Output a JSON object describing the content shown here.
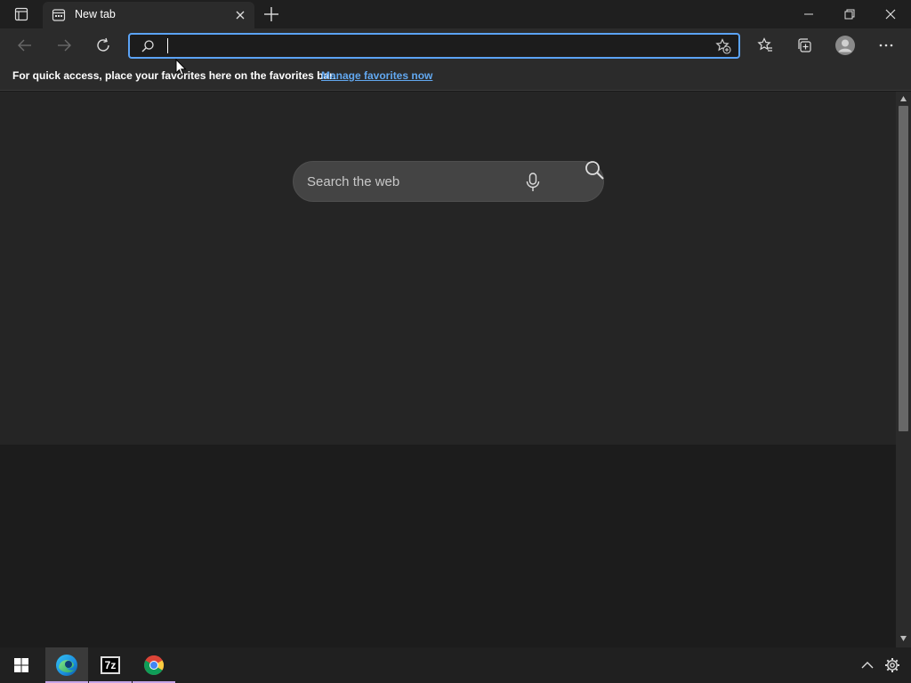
{
  "browser": {
    "tab": {
      "title": "New tab"
    },
    "address_bar": {
      "value": "",
      "placeholder": ""
    },
    "favorites_bar": {
      "message": "For quick access, place your favorites here on the favorites bar.",
      "link": "Manage favorites now"
    }
  },
  "new_tab_page": {
    "search": {
      "placeholder": "Search the web"
    }
  },
  "icons": {
    "tab_actions": "tab-actions-icon",
    "tab_page": "newtab-page-icon",
    "back": "arrow-left-icon",
    "forward": "arrow-right-icon",
    "refresh": "refresh-icon",
    "address_search": "search-icon",
    "add_favorite": "star-plus-icon",
    "favorites": "star-list-icon",
    "collections": "collections-icon",
    "profile": "avatar-icon",
    "more": "ellipsis-icon",
    "mic": "microphone-icon",
    "windows": "windows-logo-icon",
    "edge": "edge-icon",
    "seven_zip": "7zip-icon",
    "chrome": "chrome-icon",
    "tray_up": "chevron-up-icon",
    "settings": "gear-icon"
  },
  "taskbar": {
    "apps": [
      "Microsoft Edge",
      "7-Zip",
      "Google Chrome"
    ],
    "seven_zip_label": "7z"
  },
  "colors": {
    "accent": "#5ba3f5",
    "link": "#62a8f0",
    "taskbar_indicator": "#c7a4e8"
  }
}
